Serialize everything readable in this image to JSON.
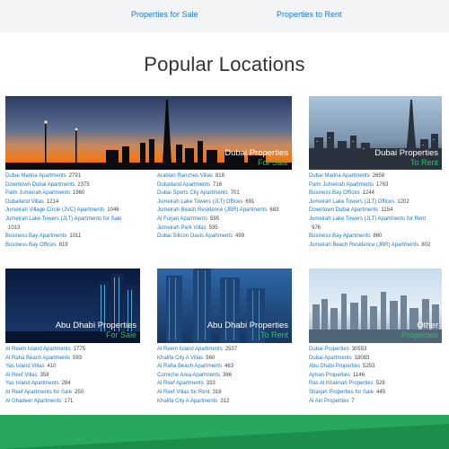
{
  "nav": {
    "sale_label": "Properties for Sale",
    "rent_label": "Properties to Rent"
  },
  "title": "Popular Locations",
  "colors": {
    "link": "#1c79c9",
    "accent_green": "#22c55e",
    "footer_green": "#1e9c55"
  },
  "cards": {
    "dubai_sale": {
      "caption": "Dubai Properties",
      "sub": "For Sale",
      "col1": [
        {
          "label": "Dubai Marina Apartments",
          "count": "2791"
        },
        {
          "label": "Downtown Dubai Apartments",
          "count": "2375"
        },
        {
          "label": "Palm Jumeirah Apartments",
          "count": "1960"
        },
        {
          "label": "Dubailand Villas",
          "count": "1214"
        },
        {
          "label": "Jumeirah Village Circle (JVC) Apartments",
          "count": "1046"
        },
        {
          "label": "Jumeirah Lake Towers (JLT) Apartments for Sale",
          "count": "1013"
        },
        {
          "label": "Business Bay Apartments",
          "count": "1011"
        },
        {
          "label": "Business Bay Offices",
          "count": "819"
        }
      ],
      "col2": [
        {
          "label": "Arabian Ranches Villas",
          "count": "818"
        },
        {
          "label": "Dubailand Apartments",
          "count": "716"
        },
        {
          "label": "Dubai Sports City Apartments",
          "count": "701"
        },
        {
          "label": "Jumeirah Lake Towers (JLT) Offices",
          "count": "691"
        },
        {
          "label": "Jumeirah Beach Residence (JBR) Apartments",
          "count": "683"
        },
        {
          "label": "Al Furjan Apartments",
          "count": "595"
        },
        {
          "label": "Jumeirah Park Villas",
          "count": "535"
        },
        {
          "label": "Dubai Silicon Oasis Apartments",
          "count": "499"
        }
      ]
    },
    "dubai_rent": {
      "caption": "Dubai Properties",
      "sub": "To Rent",
      "items": [
        {
          "label": "Dubai Marina Apartments",
          "count": "2658"
        },
        {
          "label": "Palm Jumeirah Apartments",
          "count": "1763"
        },
        {
          "label": "Business Bay Offices",
          "count": "1244"
        },
        {
          "label": "Jumeirah Lake Towers (JLT) Offices",
          "count": "1202"
        },
        {
          "label": "Downtown Dubai Apartments",
          "count": "1154"
        },
        {
          "label": "Jumeirah Lake Towers (JLT) Apartments for Rent",
          "count": "976"
        },
        {
          "label": "Business Bay Apartments",
          "count": "860"
        },
        {
          "label": "Jumeirah Beach Residence (JBR) Apartments",
          "count": "802"
        }
      ]
    },
    "abudhabi_sale": {
      "caption": "Abu Dhabi Properties",
      "sub": "For Sale",
      "items": [
        {
          "label": "Al Reem Island Apartments",
          "count": "1775"
        },
        {
          "label": "Al Raha Beach Apartments",
          "count": "593"
        },
        {
          "label": "Yas Island Villas",
          "count": "410"
        },
        {
          "label": "Al Reef Villas",
          "count": "358"
        },
        {
          "label": "Yas Island Apartments",
          "count": "284"
        },
        {
          "label": "Al Reef Apartments for Sale",
          "count": "250"
        },
        {
          "label": "Al Ghadeer Apartments",
          "count": "171"
        }
      ]
    },
    "abudhabi_rent": {
      "caption": "Abu Dhabi Properties",
      "sub": "To Rent",
      "items": [
        {
          "label": "Al Reem Island Apartments",
          "count": "2537"
        },
        {
          "label": "Khalifa City A Villas",
          "count": "560"
        },
        {
          "label": "Al Raha Beach Apartments",
          "count": "463"
        },
        {
          "label": "Corniche Area Apartments",
          "count": "366"
        },
        {
          "label": "Al Reef Apartments",
          "count": "333"
        },
        {
          "label": "Al Reef Villas for Rent",
          "count": "316"
        },
        {
          "label": "Khalifa City A Apartments",
          "count": "312"
        }
      ]
    },
    "other": {
      "caption": "Other",
      "sub": "Properties",
      "items": [
        {
          "label": "Dubai Properties",
          "count": "30553"
        },
        {
          "label": "Dubai Apartments",
          "count": "18083"
        },
        {
          "label": "Abu Dhabi Properties",
          "count": "5253"
        },
        {
          "label": "Ajman Properties",
          "count": "1146"
        },
        {
          "label": "Ras Al Khaimah Properties",
          "count": "528"
        },
        {
          "label": "Sharjah Properties for Sale",
          "count": "445"
        },
        {
          "label": "Al Ain Properties",
          "count": "7"
        }
      ]
    }
  }
}
